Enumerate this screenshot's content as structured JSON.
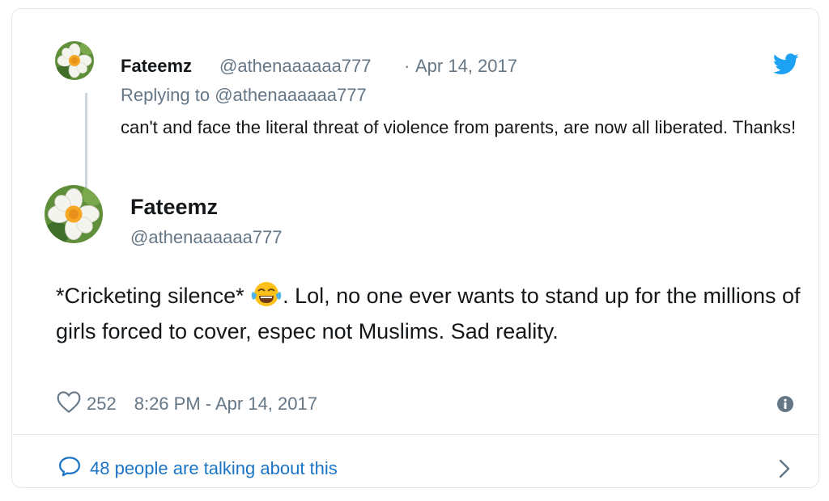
{
  "parent_tweet": {
    "name": "Fateemz",
    "handle": "@athenaaaaaa777",
    "separator": "·",
    "date": "Apr 14, 2017",
    "replying_prefix": "Replying to",
    "replying_handle": "@athenaaaaaa777",
    "text": "can't and face the literal threat of violence from parents, are now all liberated. Thanks!"
  },
  "main_tweet": {
    "name": "Fateemz",
    "handle": "@athenaaaaaa777",
    "text_before_emoji": "*Cricketing silence* ",
    "emoji": "face-with-tears-of-joy",
    "text_after_emoji": ". Lol, no one ever wants to stand up for the millions of girls forced to cover, espec not Muslims. Sad reality.",
    "likes": "252",
    "timestamp": "8:26 PM - Apr 14, 2017"
  },
  "footer": {
    "talking_label": "48 people are talking about this"
  },
  "icons": {
    "brand": "twitter-bird-icon",
    "like": "heart-icon",
    "info": "info-icon",
    "reply": "speech-bubble-icon",
    "more": "chevron-right-icon"
  },
  "colors": {
    "twitter_blue": "#1da1f2",
    "link_blue": "#1b74c5",
    "secondary_text": "#657786",
    "border": "#e1e8ed"
  }
}
